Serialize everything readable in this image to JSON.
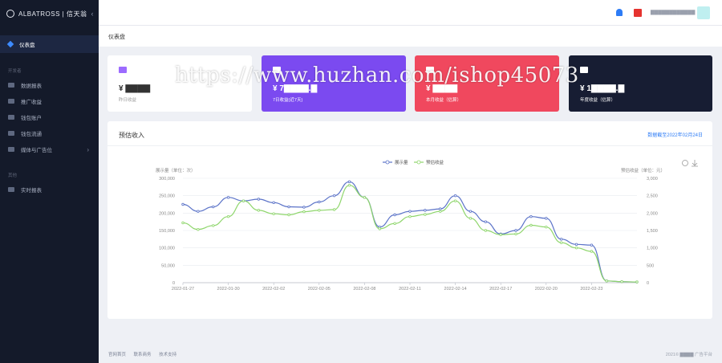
{
  "brand": {
    "name": "ALBATROSS | 信天翁"
  },
  "sidebar": {
    "active": "仪表盘",
    "group1": "开发者",
    "items": [
      "数据报表",
      "推广收益",
      "钱包账户",
      "钱包流通",
      "媒体与广告位"
    ],
    "group2": "其他",
    "items2": [
      "实时报表"
    ]
  },
  "page": {
    "title": "仪表盘"
  },
  "cards": [
    {
      "value": "¥ ▇▇▇▇",
      "label": "昨日收益"
    },
    {
      "value": "¥ 7▇▇▇▇.▇",
      "label": "7日收益(近7天)"
    },
    {
      "value": "¥ ▇▇▇▇",
      "label": "本月收益（估算）"
    },
    {
      "value": "¥ 1▇▇▇▇.▇",
      "label": "年度收益（估算）"
    }
  ],
  "panel": {
    "title": "预估收入",
    "link": "数据截至2022年02月24日"
  },
  "watermark": "https://www.huzhan.com/ishop45073",
  "footer": {
    "links": [
      "官网首页",
      "联系商务",
      "技术支持"
    ],
    "copy": "2021© ▇▇▇▇ 广告平台"
  },
  "colors": {
    "series1": "#5b73c8",
    "series2": "#8fd66c"
  },
  "chart_data": {
    "type": "line",
    "legend": [
      "展示量",
      "预估收益"
    ],
    "y_left_label": "展示量（单位：次）",
    "y_right_label": "预估收益（单位：元）",
    "y_left_ticks": [
      "0",
      "50,000",
      "100,000",
      "150,000",
      "200,000",
      "250,000",
      "300,000"
    ],
    "y_right_ticks": [
      "0",
      "500",
      "1,000",
      "1,500",
      "2,000",
      "2,500",
      "3,000"
    ],
    "x_tick_labels": [
      "2022-01-27",
      "2022-01-30",
      "2022-02-02",
      "2022-02-05",
      "2022-02-08",
      "2022-02-11",
      "2022-02-14",
      "2022-02-17",
      "2022-02-20",
      "2022-02-23"
    ],
    "x": [
      "2022-01-27",
      "2022-01-28",
      "2022-01-29",
      "2022-01-30",
      "2022-01-31",
      "2022-02-01",
      "2022-02-02",
      "2022-02-03",
      "2022-02-04",
      "2022-02-05",
      "2022-02-06",
      "2022-02-07",
      "2022-02-08",
      "2022-02-09",
      "2022-02-10",
      "2022-02-11",
      "2022-02-12",
      "2022-02-13",
      "2022-02-14",
      "2022-02-15",
      "2022-02-16",
      "2022-02-17",
      "2022-02-18",
      "2022-02-19",
      "2022-02-20",
      "2022-02-21",
      "2022-02-22",
      "2022-02-23",
      "2022-02-24",
      "2022-02-25",
      "2022-02-26"
    ],
    "series": [
      {
        "name": "展示量",
        "values": [
          225000,
          205000,
          218000,
          245000,
          235000,
          240000,
          230000,
          218000,
          217000,
          232000,
          250000,
          290000,
          245000,
          160000,
          195000,
          205000,
          208000,
          212000,
          250000,
          205000,
          175000,
          140000,
          150000,
          190000,
          185000,
          125000,
          110000,
          108000,
          5000,
          3000,
          2000
        ]
      },
      {
        "name": "预估收益",
        "values": [
          1720,
          1530,
          1640,
          1900,
          2350,
          2080,
          1980,
          1950,
          2040,
          2080,
          2100,
          2800,
          2450,
          1550,
          1700,
          1900,
          1960,
          2050,
          2350,
          1850,
          1500,
          1380,
          1400,
          1650,
          1600,
          1150,
          1000,
          900,
          50,
          30,
          20
        ]
      }
    ],
    "ylim_left": [
      0,
      300000
    ],
    "ylim_right": [
      0,
      3000
    ]
  }
}
